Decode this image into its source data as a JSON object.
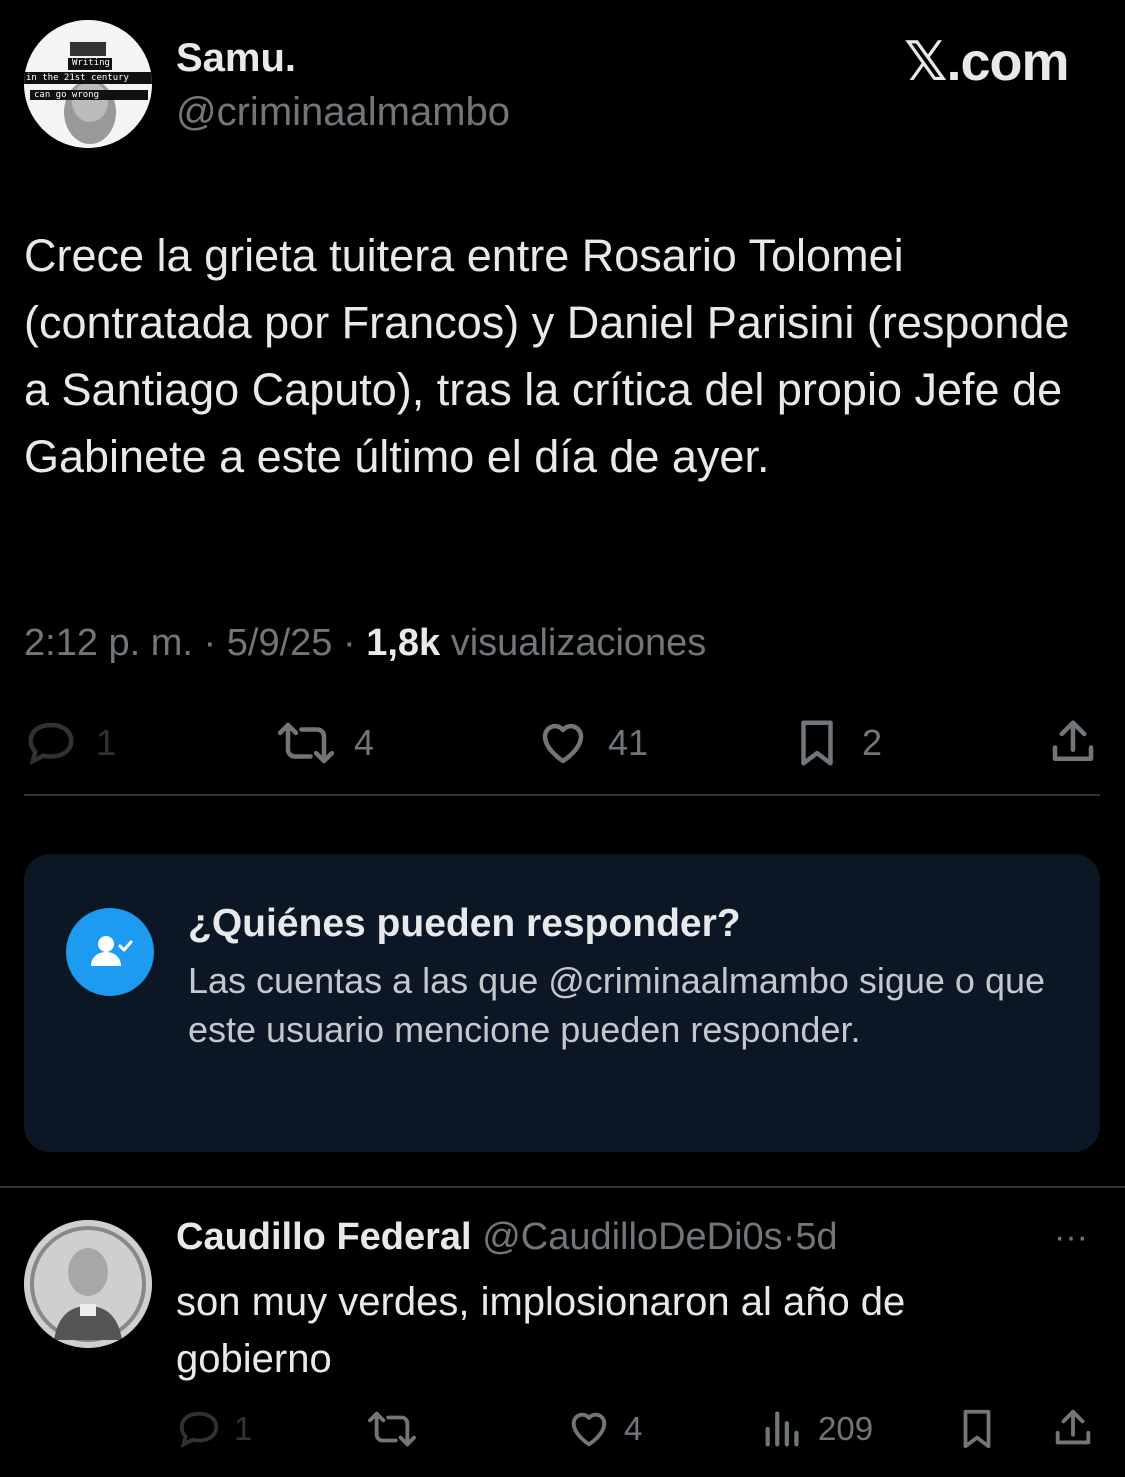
{
  "header": {
    "logo": "𝕏.com",
    "avatar_text_lines": [
      "Writing",
      "in the 21st century",
      "can go wrong"
    ]
  },
  "tweet": {
    "author_name": "Samu.",
    "author_handle": "@criminaalmambo",
    "text": "Crece la grieta tuitera entre Rosario Tolomei (contratada por Francos) y Daniel Parisini (responde a Santiago Caputo), tras la crítica del propio Jefe de Gabinete a este último el día de ayer.",
    "time": "2:12 p. m.",
    "sep": "·",
    "date": "5/9/25",
    "views_count": "1,8k",
    "views_label": "visualizaciones",
    "actions": {
      "replies": "1",
      "reposts": "4",
      "likes": "41",
      "bookmarks": "2"
    }
  },
  "reply_restriction": {
    "title": "¿Quiénes pueden responder?",
    "text": "Las cuentas a las que @criminaalmambo sigue o que este usuario mencione pueden responder.",
    "accent": "#1d9bf0",
    "background": "#0b1724"
  },
  "reply": {
    "author_name": "Caudillo Federal",
    "author_handle": "@CaudilloDeDi0s",
    "sep": "·",
    "age": "5d",
    "more": "···",
    "text": "son muy verdes, implosionaron al año de gobierno",
    "actions": {
      "replies": "1",
      "reposts": "",
      "likes": "4",
      "views": "209"
    }
  }
}
